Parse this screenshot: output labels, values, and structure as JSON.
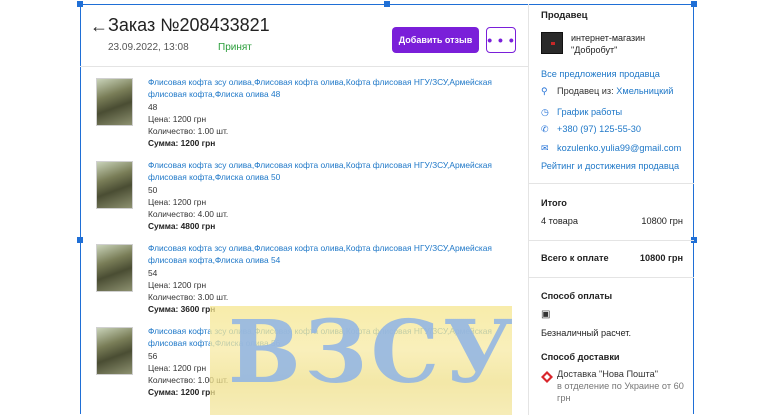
{
  "order": {
    "title": "Заказ №208433821",
    "date": "23.09.2022, 13:08",
    "status": "Принят",
    "add_review_label": "Добавить отзыв",
    "more_label": "• • •"
  },
  "items": [
    {
      "name": "Флисовая кофта зсу олива,Флисовая кофта олива,Кофта флисовая НГУ/ЗСУ,Армейская флисовая кофта,Флиска олива 48",
      "size": "48",
      "price": "Цена: 1200 грн",
      "qty": "Количество: 1.00 шт.",
      "sum": "Сумма: 1200 грн"
    },
    {
      "name": "Флисовая кофта зсу олива,Флисовая кофта олива,Кофта флисовая НГУ/ЗСУ,Армейская флисовая кофта,Флиска олива 50",
      "size": "50",
      "price": "Цена: 1200 грн",
      "qty": "Количество: 4.00 шт.",
      "sum": "Сумма: 4800 грн"
    },
    {
      "name": "Флисовая кофта зсу олива,Флисовая кофта олива,Кофта флисовая НГУ/ЗСУ,Армейская флисовая кофта,Флиска олива 54",
      "size": "54",
      "price": "Цена: 1200 грн",
      "qty": "Количество: 3.00 шт.",
      "sum": "Сумма: 3600 грн"
    },
    {
      "name": "Флисовая кофта зсу олива,Флисовая кофта олива,Кофта флисовая НГУ/ЗСУ,Армейская флисовая кофта,Флиска олива 56",
      "size": "56",
      "price": "Цена: 1200 грн",
      "qty": "Количество: 1.00 шт.",
      "sum": "Сумма: 1200 грн"
    }
  ],
  "seller": {
    "heading": "Продавец",
    "name_line1": "интернет-магазин",
    "name_line2": "\"Добробут\"",
    "all_offers": "Все предложения продавца",
    "location_prefix": "Продавец из:",
    "location_city": "Хмельницкий",
    "schedule": "График работы",
    "phone": "+380 (97) 125-55-30",
    "email": "kozulenko.yulia99@gmail.com",
    "rating": "Рейтинг и достижения продавца"
  },
  "totals": {
    "heading": "Итого",
    "count_label": "4 товара",
    "count_value": "10800 грн",
    "pay_label": "Всего к оплате",
    "pay_value": "10800 грн"
  },
  "payment": {
    "heading": "Способ оплаты",
    "method": "Безналичный расчет."
  },
  "delivery": {
    "heading": "Способ доставки",
    "carrier": "Доставка \"Нова Пошта\"",
    "detail_line1": "в отделение по Украине от 60",
    "detail_line2": "грн"
  },
  "watermark": "ВЗСУ",
  "colors": {
    "accent": "#7a1fd9",
    "link": "#1f78c8",
    "status": "#2a9d3a",
    "selection": "#1f6fd6"
  }
}
